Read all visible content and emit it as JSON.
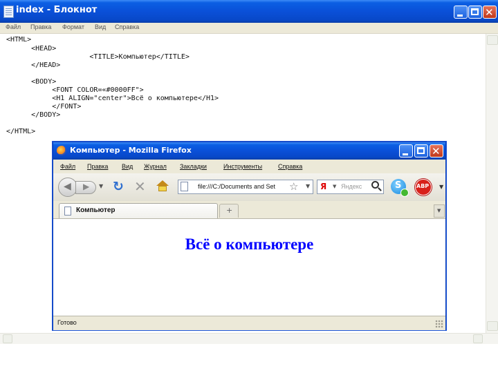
{
  "notepad": {
    "title": "index - Блокнот",
    "menu": [
      "Файл",
      "Правка",
      "Формат",
      "Вид",
      "Справка"
    ],
    "code_lines": [
      "<HTML>",
      "      <HEAD>",
      "                    <TITLE>Компьютер</TITLE>",
      "      </HEAD>",
      "",
      "      <BODY>",
      "           <FONT COLOR=«#0000FF\">",
      "           <H1 ALIGN=\"center\">Всё о компьютере</H1>",
      "           </FONT>",
      "      </BODY>",
      "",
      "</HTML>"
    ]
  },
  "firefox": {
    "title": "Компьютер - Mozilla Firefox",
    "menu": [
      "Файл",
      "Правка",
      "Вид",
      "Журнал",
      "Закладки",
      "Инструменты",
      "Справка"
    ],
    "url": "file:///C:/Documents and Set",
    "search_placeholder": "Яндекс",
    "search_engine_glyph": "Я",
    "tab_label": "Компьютер",
    "page_heading": "Всё о компьютере",
    "status": "Готово",
    "abp_label": "ABP",
    "skype_label": "S",
    "colors": {
      "titlebar": "#0a50d8",
      "heading": "#0000ff",
      "chrome": "#ece9d8"
    }
  },
  "icons": {
    "window_close": "close-icon",
    "window_minimize": "minimize-icon",
    "window_maximize": "maximize-icon",
    "back": "back-arrow-icon",
    "forward": "forward-arrow-icon",
    "reload": "reload-icon",
    "stop": "stop-icon",
    "home": "home-icon",
    "bookmark": "star-icon",
    "search": "magnifier-icon"
  }
}
